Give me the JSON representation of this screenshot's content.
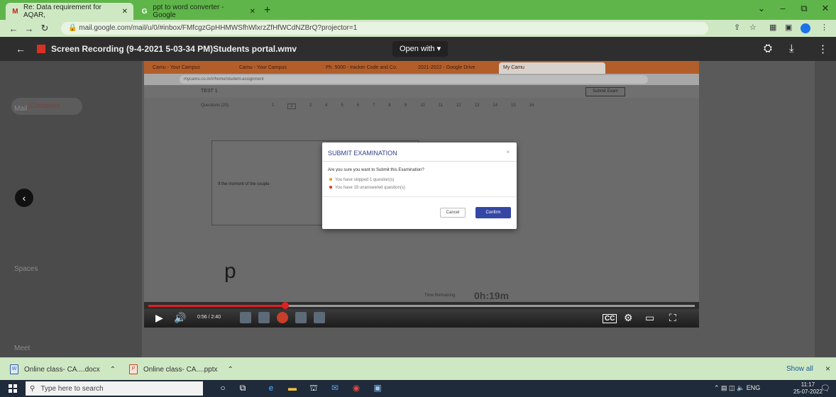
{
  "browser": {
    "tabs": [
      {
        "favicon": "M",
        "title": "Re: Data requirement for AQAR, ",
        "active": true
      },
      {
        "favicon": "G",
        "title": "ppt to word converter - Google ",
        "active": false
      }
    ],
    "new_tab": "+",
    "url": "mail.google.com/mail/u/0/#inbox/FMfcgzGpHHMWSfhWlxrzZfHfWCdNZBrQ?projector=1"
  },
  "viewer": {
    "title": "Screen Recording (9-4-2021 5-03-34 PM)Students portal.wmv",
    "open_with": "Open with"
  },
  "gmail_sidebar": {
    "compose": "Compose",
    "mail": "Mail",
    "spaces": "Spaces",
    "meet": "Meet"
  },
  "recording": {
    "inner_tabs": [
      "Camu - Your Campus",
      "Camu - Your Campus",
      "Ph. 5000 - tracker Code and Co.",
      "2021-2022 - Google Drive",
      "My Camu"
    ],
    "inner_url": "mycamu.co.in/#/home/student-assignment",
    "exam_header": "TEST 1",
    "submit_exam_top": "Submit Exam",
    "questions_label": "Questions (20)",
    "question_numbers": [
      "1",
      "2",
      "3",
      "4",
      "5",
      "6",
      "7",
      "8",
      "9",
      "10",
      "11",
      "12",
      "13",
      "14",
      "15",
      "16"
    ],
    "question_text": "If the moment of the couple",
    "answer_letter": "p",
    "timer_label": "Time Remaining",
    "timer_value": "0h:19m"
  },
  "modal": {
    "title": "SUBMIT EXAMINATION",
    "question": "Are you sure you want to Submit this Examination?",
    "item_skipped": "You have skipped 1 question(s)",
    "item_unanswered": "You have 19 unanswered question(s)",
    "cancel": "Cancel",
    "confirm": "Confirm",
    "close": "×"
  },
  "player": {
    "time": "0:56 / 2:40",
    "progress": 0.25,
    "cc": "CC"
  },
  "downloads": {
    "items": [
      "Online class- CA....docx",
      "Online class- CA....pptx"
    ],
    "show_all": "Show all",
    "close": "×"
  },
  "taskbar": {
    "search_placeholder": "Type here to search",
    "lang": "ENG",
    "time": "11:17",
    "date": "25-07-2022"
  },
  "colors": {
    "tabbar": "#5fb54a",
    "toolbar": "#cfe8c4",
    "confirm_button": "#3547a5",
    "progress": "#e02020"
  }
}
